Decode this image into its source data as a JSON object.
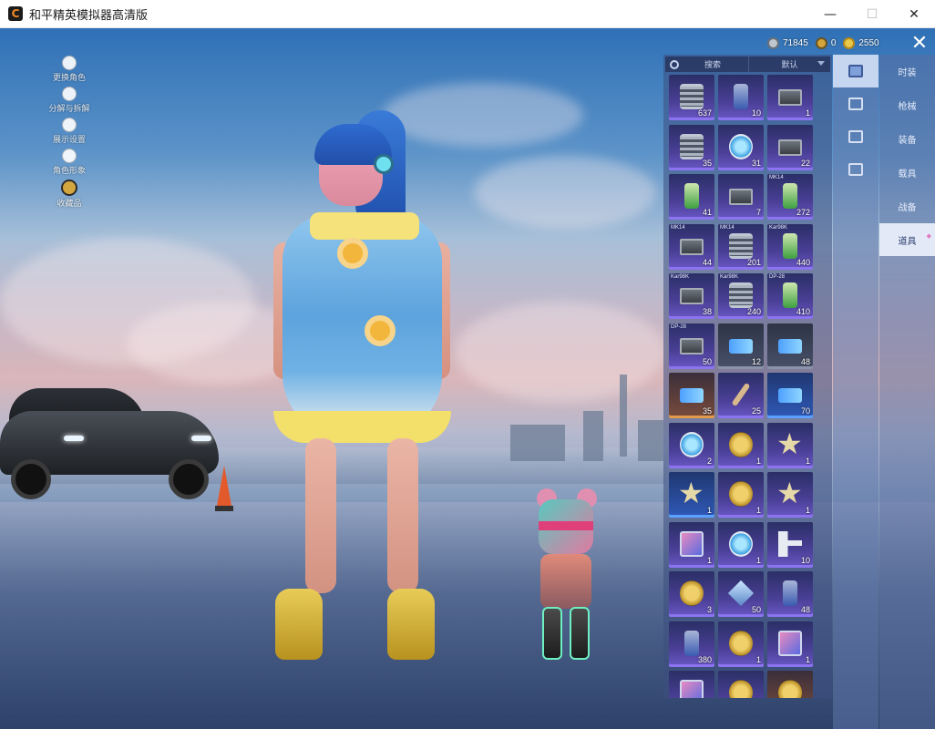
{
  "window": {
    "title": "和平精英模拟器高清版",
    "logo_text": "C",
    "minimize_symbol": "—",
    "maximize_symbol": "☐",
    "close_symbol": "✕"
  },
  "left_menu": [
    {
      "label": "更换角色",
      "icon": "person-icon"
    },
    {
      "label": "分解与拆解",
      "icon": "puzzle-icon"
    },
    {
      "label": "展示设置",
      "icon": "eye-icon"
    },
    {
      "label": "角色形象",
      "icon": "mask-icon"
    },
    {
      "label": "收藏品",
      "icon": "medal-icon"
    }
  ],
  "currency": [
    {
      "icon": "silver-coin-icon",
      "value": "71845"
    },
    {
      "icon": "gold-token-icon",
      "value": "0"
    },
    {
      "icon": "gold-coin-icon",
      "value": "2550"
    }
  ],
  "close_button": "✕",
  "inventory": {
    "search_label": "搜索",
    "sort_label": "默认",
    "items": [
      {
        "icon": "spring",
        "rarity": "purple",
        "tag": "",
        "count": "637"
      },
      {
        "icon": "can",
        "rarity": "purple",
        "tag": "",
        "count": "10"
      },
      {
        "icon": "crate",
        "rarity": "purple",
        "tag": "",
        "count": "1"
      },
      {
        "icon": "spring",
        "rarity": "purple",
        "tag": "",
        "count": "35"
      },
      {
        "icon": "disc",
        "rarity": "purple",
        "tag": "",
        "count": "31"
      },
      {
        "icon": "crate",
        "rarity": "purple",
        "tag": "",
        "count": "22"
      },
      {
        "icon": "can-green",
        "rarity": "purple",
        "tag": "",
        "count": "41"
      },
      {
        "icon": "crate",
        "rarity": "purple",
        "tag": "",
        "count": "7"
      },
      {
        "icon": "can-green",
        "rarity": "purple",
        "tag": "MK14",
        "count": "272"
      },
      {
        "icon": "crate",
        "rarity": "purple",
        "tag": "MK14",
        "count": "44"
      },
      {
        "icon": "spring",
        "rarity": "purple",
        "tag": "MK14",
        "count": "201"
      },
      {
        "icon": "can-green",
        "rarity": "purple",
        "tag": "Kar98K",
        "count": "440"
      },
      {
        "icon": "crate",
        "rarity": "purple",
        "tag": "Kar98K",
        "count": "38"
      },
      {
        "icon": "spring",
        "rarity": "purple",
        "tag": "Kar98K",
        "count": "240"
      },
      {
        "icon": "can-green",
        "rarity": "purple",
        "tag": "DP-28",
        "count": "410"
      },
      {
        "icon": "crate",
        "rarity": "purple",
        "tag": "DP-28",
        "count": "50"
      },
      {
        "icon": "ticket",
        "rarity": "gray",
        "tag": "",
        "count": "12"
      },
      {
        "icon": "ticket",
        "rarity": "gray",
        "tag": "",
        "count": "48"
      },
      {
        "icon": "ticket",
        "rarity": "orange",
        "tag": "",
        "count": "35"
      },
      {
        "icon": "stick",
        "rarity": "purple",
        "tag": "",
        "count": "25"
      },
      {
        "icon": "ticket",
        "rarity": "blue",
        "tag": "",
        "count": "70"
      },
      {
        "icon": "disc",
        "rarity": "purple",
        "tag": "",
        "count": "2"
      },
      {
        "icon": "coin",
        "rarity": "purple",
        "tag": "",
        "count": "1"
      },
      {
        "icon": "star",
        "rarity": "purple",
        "tag": "",
        "count": "1"
      },
      {
        "icon": "star",
        "rarity": "blue",
        "tag": "",
        "count": "1"
      },
      {
        "icon": "coin",
        "rarity": "purple",
        "tag": "",
        "count": "1"
      },
      {
        "icon": "star",
        "rarity": "purple",
        "tag": "",
        "count": "1"
      },
      {
        "icon": "card",
        "rarity": "purple",
        "tag": "",
        "count": "1"
      },
      {
        "icon": "disc",
        "rarity": "purple",
        "tag": "",
        "count": "1"
      },
      {
        "icon": "key",
        "rarity": "purple",
        "tag": "",
        "count": "10"
      },
      {
        "icon": "coin",
        "rarity": "purple",
        "tag": "",
        "count": "3"
      },
      {
        "icon": "diamond",
        "rarity": "purple",
        "tag": "",
        "count": "50"
      },
      {
        "icon": "can",
        "rarity": "purple",
        "tag": "",
        "count": "48"
      },
      {
        "icon": "can",
        "rarity": "purple",
        "tag": "",
        "count": "380"
      },
      {
        "icon": "coin",
        "rarity": "purple",
        "tag": "",
        "count": "1"
      },
      {
        "icon": "card",
        "rarity": "purple",
        "tag": "",
        "count": "1"
      },
      {
        "icon": "card",
        "rarity": "purple",
        "tag": "",
        "count": ""
      },
      {
        "icon": "coin",
        "rarity": "purple",
        "tag": "",
        "count": ""
      },
      {
        "icon": "coin",
        "rarity": "orange",
        "tag": "",
        "count": ""
      }
    ]
  },
  "category_tabs": [
    {
      "icon": "phone-icon",
      "active": true
    },
    {
      "icon": "chest-icon",
      "active": false
    },
    {
      "icon": "sparkle-icon",
      "active": false
    },
    {
      "icon": "ticket-icon",
      "active": false
    }
  ],
  "type_tabs": [
    {
      "label": "时装",
      "active": false
    },
    {
      "label": "枪械",
      "active": false
    },
    {
      "label": "装备",
      "active": false
    },
    {
      "label": "载具",
      "active": false
    },
    {
      "label": "战备",
      "active": false
    },
    {
      "label": "道具",
      "active": true
    }
  ]
}
